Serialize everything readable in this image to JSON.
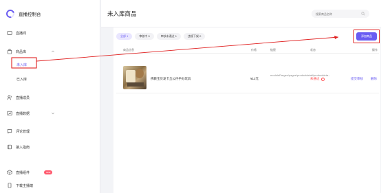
{
  "app": {
    "title": "直播控制台",
    "accent_color": "#6a5cf2",
    "annotation_color": "#e02020"
  },
  "sidebar": {
    "items": [
      {
        "label": "直播间",
        "icon": "tv-icon"
      },
      {
        "label": "商品库",
        "icon": "bag-icon",
        "expanded": true,
        "children": [
          {
            "label": "未入库",
            "active": true
          },
          {
            "label": "已入库",
            "active": false
          }
        ]
      },
      {
        "label": "直播成员",
        "icon": "people-icon"
      },
      {
        "label": "直播数据",
        "icon": "chart-icon"
      },
      {
        "label": "评论管理",
        "icon": "comment-icon"
      },
      {
        "label": "接入指南",
        "icon": "book-icon"
      }
    ],
    "bottom": [
      {
        "label": "直播组件",
        "icon": "cube-icon",
        "badge": "new"
      },
      {
        "label": "下载主播端",
        "icon": "phone-icon"
      }
    ]
  },
  "header": {
    "page_title": "未入库商品",
    "search_placeholder": "搜索商品名称"
  },
  "filters": [
    {
      "label": "全部 1",
      "active": true
    },
    {
      "label": "审核中 0",
      "active": false
    },
    {
      "label": "审核未通过 1",
      "active": false
    },
    {
      "label": "违规下架 0",
      "active": false
    }
  ],
  "add_button": {
    "label": "添加商品"
  },
  "table": {
    "columns": [
      "商品信息",
      "价格",
      "链接",
      "状态",
      "操作"
    ],
    "rows": [
      {
        "name": "佛教宝贝发卡丘公仔手办玩具",
        "price": "¥12元",
        "link": "moduleParges/pages/productdetail/productdeta...",
        "status": "未通过",
        "actions": [
          "提交审核",
          "删除"
        ]
      }
    ]
  }
}
